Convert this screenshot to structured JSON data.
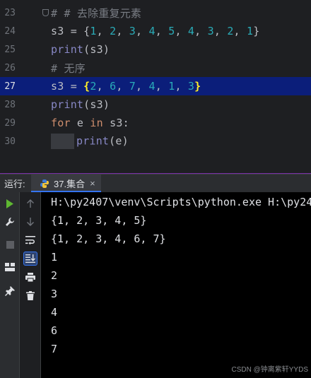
{
  "editor": {
    "lines": [
      {
        "num": "23",
        "tokens": [
          {
            "t": "# # 去除重复元素",
            "c": "cmt"
          }
        ]
      },
      {
        "num": "24",
        "tokens": [
          {
            "t": "s3 = {",
            "c": "txt"
          },
          {
            "t": "1",
            "c": "num"
          },
          {
            "t": ", ",
            "c": "txt"
          },
          {
            "t": "2",
            "c": "num"
          },
          {
            "t": ", ",
            "c": "txt"
          },
          {
            "t": "3",
            "c": "num"
          },
          {
            "t": ", ",
            "c": "txt"
          },
          {
            "t": "4",
            "c": "num"
          },
          {
            "t": ", ",
            "c": "txt"
          },
          {
            "t": "5",
            "c": "num"
          },
          {
            "t": ", ",
            "c": "txt"
          },
          {
            "t": "4",
            "c": "num"
          },
          {
            "t": ", ",
            "c": "txt"
          },
          {
            "t": "3",
            "c": "num"
          },
          {
            "t": ", ",
            "c": "txt"
          },
          {
            "t": "2",
            "c": "num"
          },
          {
            "t": ", ",
            "c": "txt"
          },
          {
            "t": "1",
            "c": "num"
          },
          {
            "t": "}",
            "c": "txt"
          }
        ]
      },
      {
        "num": "25",
        "tokens": [
          {
            "t": "print",
            "c": "fn"
          },
          {
            "t": "(s3)",
            "c": "txt"
          }
        ]
      },
      {
        "num": "26",
        "tokens": [
          {
            "t": "# 无序",
            "c": "cmt"
          }
        ]
      },
      {
        "num": "27",
        "current": true,
        "tokens": [
          {
            "t": "s3 = ",
            "c": "txt"
          },
          {
            "t": "{",
            "c": "brace-hl"
          },
          {
            "t": "2",
            "c": "num"
          },
          {
            "t": ", ",
            "c": "txt"
          },
          {
            "t": "6",
            "c": "num"
          },
          {
            "t": ", ",
            "c": "txt"
          },
          {
            "t": "7",
            "c": "num"
          },
          {
            "t": ", ",
            "c": "txt"
          },
          {
            "t": "4",
            "c": "num"
          },
          {
            "t": ", ",
            "c": "txt"
          },
          {
            "t": "1",
            "c": "num"
          },
          {
            "t": ", ",
            "c": "txt"
          },
          {
            "t": "3",
            "c": "num"
          },
          {
            "t": "}",
            "c": "brace-hl"
          }
        ]
      },
      {
        "num": "28",
        "tokens": [
          {
            "t": "print",
            "c": "fn"
          },
          {
            "t": "(s3)",
            "c": "txt"
          }
        ]
      },
      {
        "num": "29",
        "tokens": [
          {
            "t": "for",
            "c": "kw"
          },
          {
            "t": " e ",
            "c": "txt"
          },
          {
            "t": "in",
            "c": "kw"
          },
          {
            "t": " s3:",
            "c": "txt"
          }
        ]
      },
      {
        "num": "30",
        "indent": true,
        "tokens": [
          {
            "t": "print",
            "c": "fn"
          },
          {
            "t": "(e)",
            "c": "txt"
          }
        ]
      }
    ]
  },
  "run": {
    "title": "运行:",
    "tab_label": "37.集合",
    "tab_close": "×",
    "console_lines": [
      "H:\\py2407\\venv\\Scripts\\python.exe H:\\py24",
      "{1, 2, 3, 4, 5}",
      "{1, 2, 3, 4, 6, 7}",
      "1",
      "2",
      "3",
      "4",
      "6",
      "7"
    ]
  },
  "watermark": "CSDN @钟离紫轩YYDS",
  "colors": {
    "accent": "#3574f0",
    "run_green": "#5fb832",
    "current_line": "#0b1e7a"
  }
}
